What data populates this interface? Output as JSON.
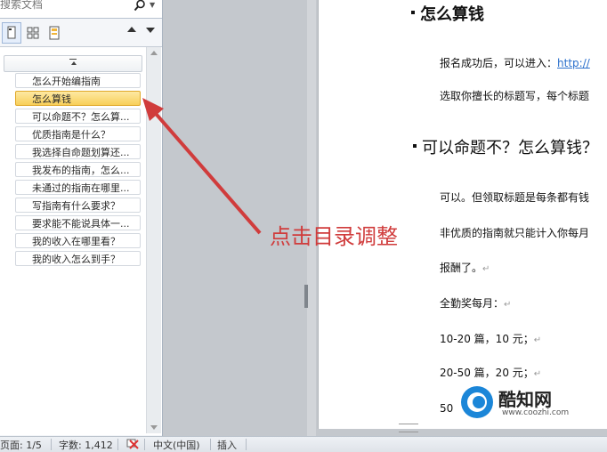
{
  "nav": {
    "search_placeholder": "搜索文档",
    "headings": [
      {
        "label": "怎么开始编指南",
        "selected": false
      },
      {
        "label": "怎么算钱",
        "selected": true
      },
      {
        "label": "可以命题不？怎么算...",
        "selected": false
      },
      {
        "label": "优质指南是什么？",
        "selected": false
      },
      {
        "label": "我选择自命题划算还...",
        "selected": false
      },
      {
        "label": "我发布的指南，怎么...",
        "selected": false
      },
      {
        "label": "未通过的指南在哪里...",
        "selected": false
      },
      {
        "label": "写指南有什么要求？",
        "selected": false
      },
      {
        "label": "要求能不能说具体一...",
        "selected": false
      },
      {
        "label": "我的收入在哪里看？",
        "selected": false
      },
      {
        "label": "我的收入怎么到手？",
        "selected": false
      }
    ]
  },
  "document": {
    "heading1": "怎么算钱",
    "p1_text": "报名成功后，可以进入：",
    "p1_link": "http://",
    "p2": "选取你擅长的标题写，每个标题",
    "heading2": "可以命题不？怎么算钱？",
    "p3": "可以。但领取标题是每条都有钱",
    "p4": "非优质的指南就只能计入你每月",
    "p5": "报酬了。",
    "p6": "全勤奖每月：",
    "p7": "10-20 篇，10 元；",
    "p8": "20-50 篇，20 元；",
    "p9": "50",
    "para_mark": "↵"
  },
  "annotation": "点击目录调整",
  "watermark": {
    "name": "酷知网",
    "url": "www.coozhi.com"
  },
  "status": {
    "page": "页面: 1/5",
    "words": "字数: 1,412",
    "language": "中文(中国)",
    "mode": "插入"
  },
  "colors": {
    "annotation": "#d03c3c",
    "selected_heading": "#f8cf5a",
    "link": "#2a6fcc"
  }
}
